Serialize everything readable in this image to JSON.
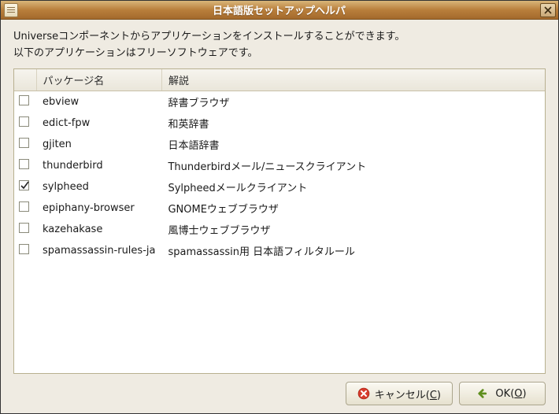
{
  "window": {
    "title": "日本語版セットアップヘルパ"
  },
  "intro": {
    "line1": "Universeコンポーネントからアプリケーションをインストールすることができます。",
    "line2": "以下のアプリケーションはフリーソフトウェアです。"
  },
  "table": {
    "headers": {
      "package": "パッケージ名",
      "description": "解説"
    },
    "rows": [
      {
        "checked": false,
        "package": "ebview",
        "description": "辞書ブラウザ"
      },
      {
        "checked": false,
        "package": "edict-fpw",
        "description": "和英辞書"
      },
      {
        "checked": false,
        "package": "gjiten",
        "description": "日本語辞書"
      },
      {
        "checked": false,
        "package": "thunderbird",
        "description": "Thunderbirdメール/ニュースクライアント"
      },
      {
        "checked": true,
        "package": "sylpheed",
        "description": "Sylpheedメールクライアント"
      },
      {
        "checked": false,
        "package": "epiphany-browser",
        "description": "GNOMEウェブブラウザ"
      },
      {
        "checked": false,
        "package": "kazehakase",
        "description": "風博士ウェブブラウザ"
      },
      {
        "checked": false,
        "package": "spamassassin-rules-ja",
        "description": "spamassassin用 日本語フィルタルール"
      }
    ]
  },
  "buttons": {
    "cancel": {
      "label": "キャンセル",
      "mnemonic": "C"
    },
    "ok": {
      "label": "OK",
      "mnemonic": "O"
    }
  },
  "icons": {
    "app": "list-icon",
    "close": "close-icon",
    "cancel": "cancel-icon",
    "ok": "ok-arrow-icon"
  }
}
